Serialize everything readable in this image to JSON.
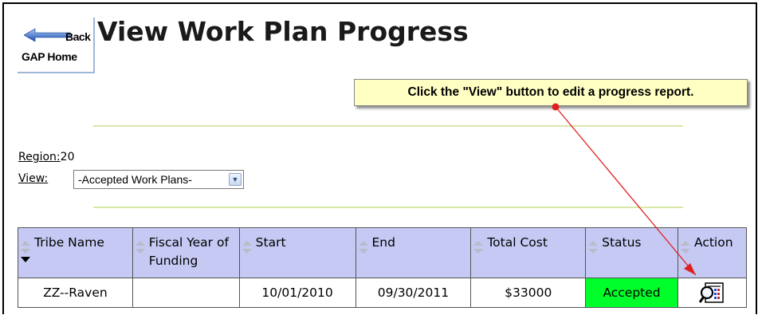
{
  "back_button": {
    "back_label": "Back",
    "home_label": "GAP Home"
  },
  "page": {
    "title": "View Work Plan Progress"
  },
  "callout": {
    "text": "Click the \"View\" button to edit a progress report."
  },
  "region": {
    "label": "Region:",
    "value": "20"
  },
  "view_filter": {
    "label": "View:",
    "selected": "-Accepted Work Plans-"
  },
  "table": {
    "headers": [
      "Tribe Name",
      "Fiscal Year of Funding",
      "Start",
      "End",
      "Total Cost",
      "Status",
      "Action"
    ],
    "rows": [
      {
        "tribe": "ZZ--Raven",
        "fiscal_year": "",
        "start": "10/01/2010",
        "end": "09/30/2011",
        "total_cost": "$33000",
        "status": "Accepted",
        "action_icon": "view-report-icon"
      }
    ]
  },
  "colors": {
    "header_bg": "#c5c9f3",
    "status_accepted": "#00ff2a",
    "callout_bg": "#ffffc4",
    "annotation_arrow": "#e02020",
    "rule": "#d8e8a8"
  }
}
